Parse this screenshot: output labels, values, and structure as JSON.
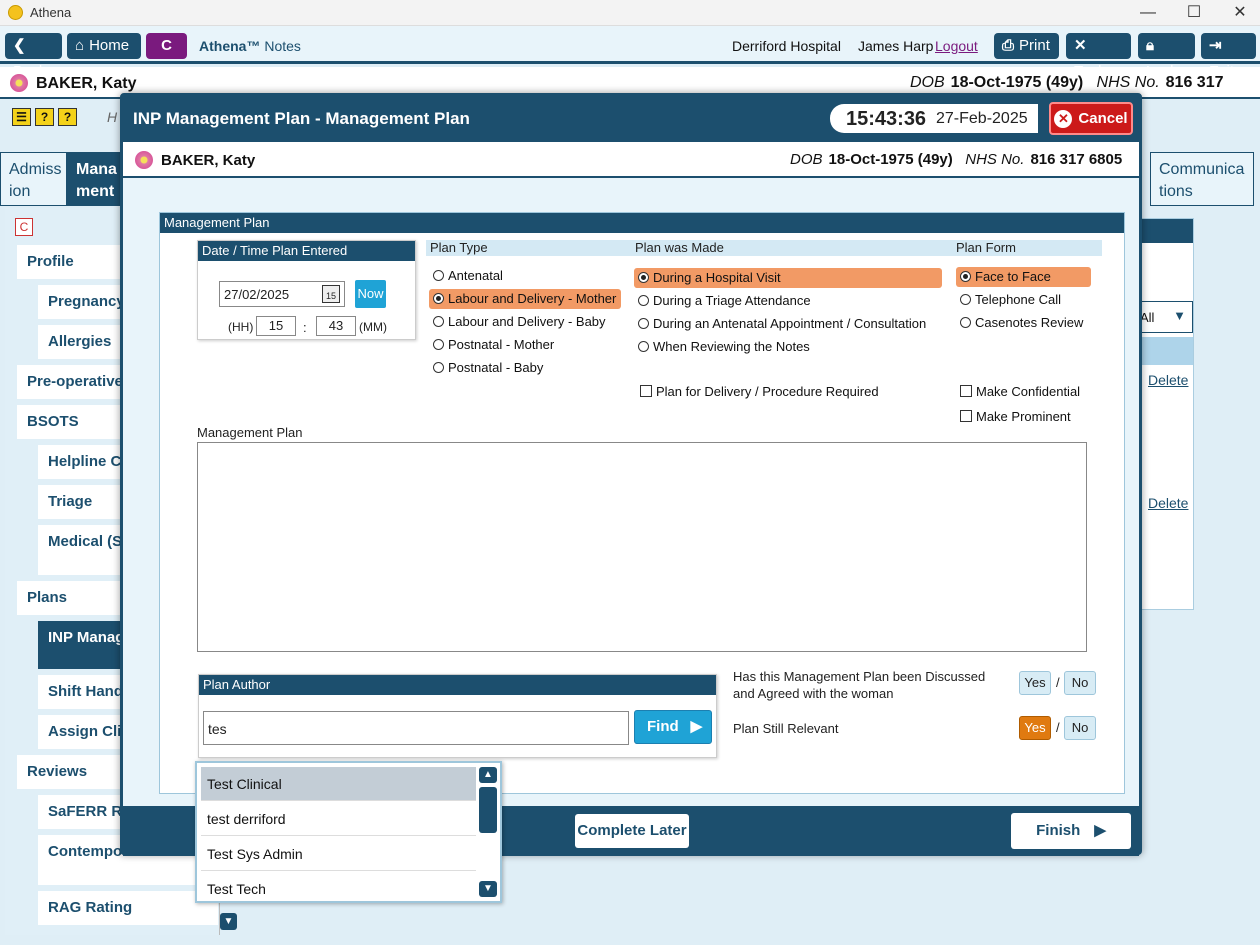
{
  "window": {
    "title": "Athena",
    "minimize": "—",
    "maximize": "☐",
    "close": "✕"
  },
  "toolbar": {
    "back": "Back",
    "home": "Home",
    "c_badge": "C",
    "app_name": "Athena™",
    "app_sub": "Notes",
    "hospital": "Derriford Hospital",
    "user": "James Harp",
    "logout": "Logout",
    "print": "Print",
    "tools": "Tools",
    "lock": "Lock",
    "exit": "Exit"
  },
  "patient": {
    "name": "BAKER, Katy",
    "dob_label": "DOB",
    "dob": "18-Oct-1975 (49y)",
    "nhs_label": "NHS No.",
    "nhs": "816 317 6805"
  },
  "background": {
    "h_letter": "H",
    "tabs": [
      {
        "label": "Admiss ion"
      },
      {
        "label": "Mana ment"
      },
      {
        "label": "Communica tions"
      }
    ],
    "sidebar": [
      {
        "label": "Profile"
      },
      {
        "label": "Pregnancy"
      },
      {
        "label": "Allergies"
      },
      {
        "label": "Pre-operative"
      },
      {
        "label": "BSOTS"
      },
      {
        "label": "Helpline Co"
      },
      {
        "label": "Triage"
      },
      {
        "label": "Medical (Sa Review"
      },
      {
        "label": "Plans"
      },
      {
        "label": "INP Manag Plan"
      },
      {
        "label": "Shift Hando"
      },
      {
        "label": "Assign Clin"
      },
      {
        "label": "Reviews"
      },
      {
        "label": "SaFERR Rev"
      },
      {
        "label": "Contempor Notes"
      },
      {
        "label": "RAG Rating"
      }
    ],
    "right_filter": "All",
    "delete1": "Delete",
    "delete2": "Delete"
  },
  "modal": {
    "title": "INP Management Plan - Management Plan",
    "time": "15:43:36",
    "date": "27-Feb-2025",
    "cancel": "Cancel",
    "section_title": "Management Plan",
    "datetime_box": {
      "title": "Date / Time Plan Entered",
      "date_value": "27/02/2025",
      "cal_day": "15",
      "now": "Now",
      "hh_label": "(HH)",
      "hh": "15",
      "sep": ":",
      "mm": "43",
      "mm_label": "(MM)"
    },
    "plan_type": {
      "header": "Plan Type",
      "options": [
        "Antenatal",
        "Labour and Delivery - Mother",
        "Labour and Delivery - Baby",
        "Postnatal - Mother",
        "Postnatal - Baby"
      ],
      "selected": "Labour and Delivery - Mother"
    },
    "plan_made": {
      "header": "Plan was Made",
      "options": [
        "During a Hospital Visit",
        "During a Triage Attendance",
        "During an Antenatal Appointment / Consultation",
        "When Reviewing the Notes"
      ],
      "selected": "During a Hospital Visit"
    },
    "plan_form": {
      "header": "Plan Form",
      "options": [
        "Face to Face",
        "Telephone Call",
        "Casenotes Review"
      ],
      "selected": "Face to Face"
    },
    "delivery_check": "Plan for Delivery / Procedure Required",
    "confidential_check": "Make Confidential",
    "prominent_check": "Make Prominent",
    "plan_label": "Management Plan",
    "plan_text": "",
    "author": {
      "title": "Plan Author",
      "value": "tes",
      "find": "Find"
    },
    "discussed": {
      "question": "Has this Management Plan been Discussed and Agreed with the woman",
      "yes": "Yes",
      "slash": "/",
      "no": "No"
    },
    "relevant": {
      "question": "Plan Still Relevant",
      "yes": "Yes",
      "slash": "/",
      "no": "No",
      "selected": "Yes"
    },
    "complete_later": "Complete Later",
    "finish": "Finish"
  },
  "dropdown": {
    "items": [
      "Test Clinical",
      "test derriford",
      "Test Sys Admin",
      "Test Tech"
    ],
    "highlighted": "Test Clinical"
  },
  "colors": {
    "navy": "#1c4f6e",
    "purple": "#7a1a7e",
    "orange_sel": "#f29a65",
    "yes_on": "#e07a10",
    "cancel_red": "#cc1a1a",
    "find_blue": "#1fa3d6"
  }
}
